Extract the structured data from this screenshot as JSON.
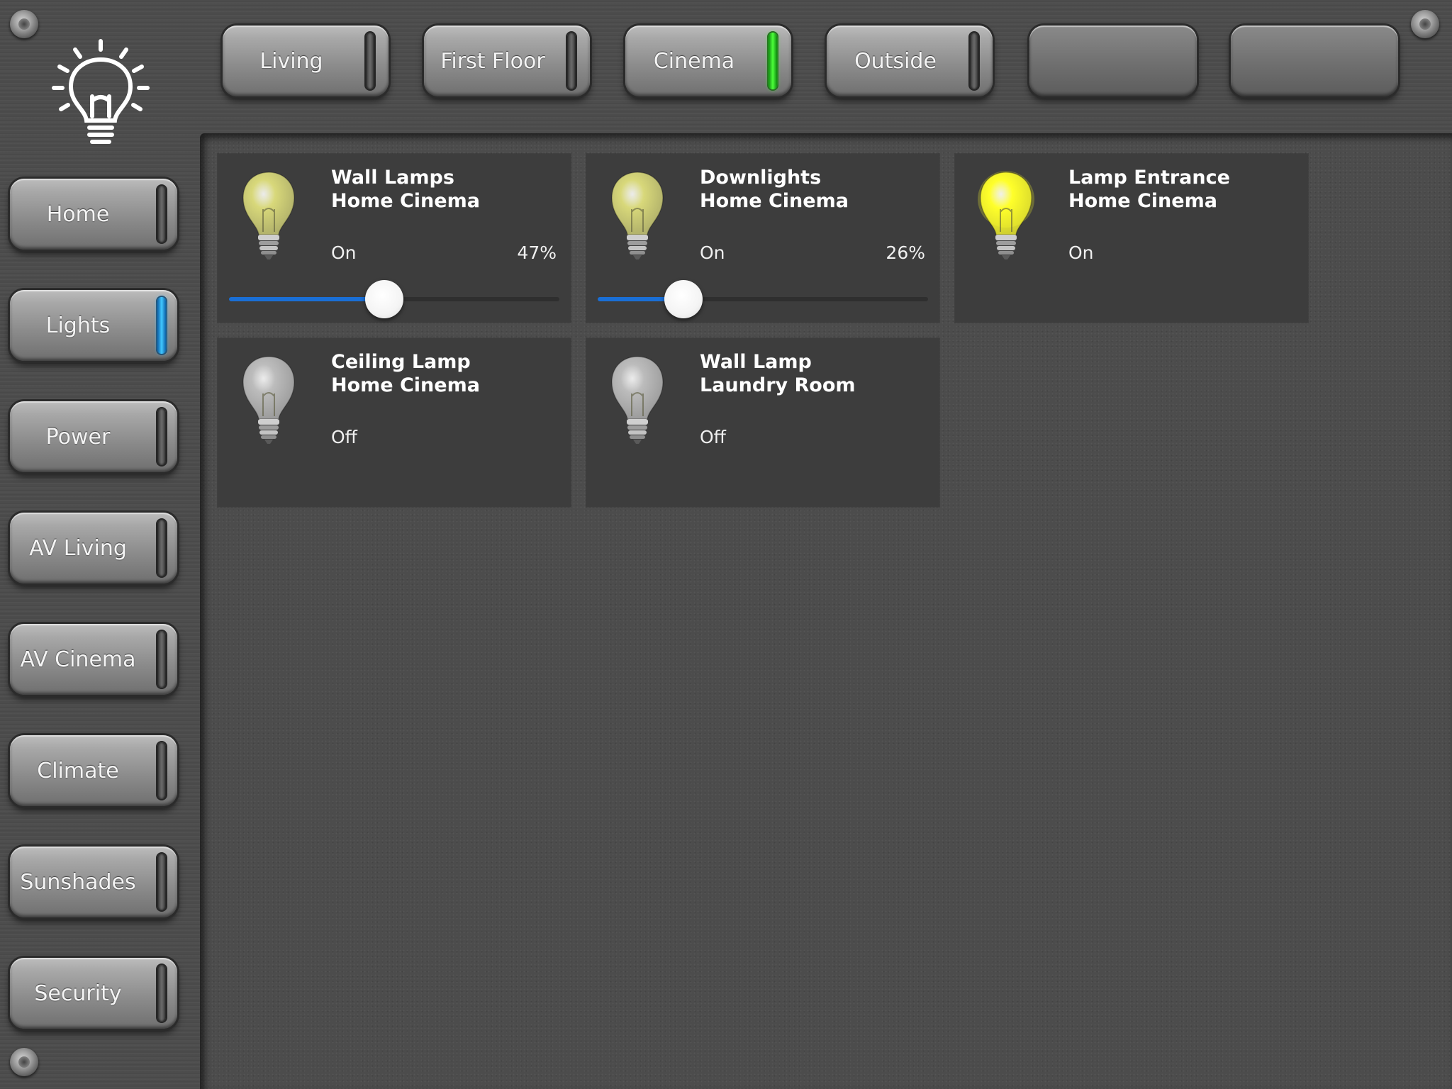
{
  "tabs": [
    {
      "label": "Living",
      "indicator": "off"
    },
    {
      "label": "First Floor",
      "indicator": "off"
    },
    {
      "label": "Cinema",
      "indicator": "green"
    },
    {
      "label": "Outside",
      "indicator": "off"
    },
    {
      "label": "",
      "indicator": "none"
    },
    {
      "label": "",
      "indicator": "none"
    }
  ],
  "sidebar": {
    "items": [
      {
        "label": "Home",
        "indicator": "off"
      },
      {
        "label": "Lights",
        "indicator": "blue"
      },
      {
        "label": "Power",
        "indicator": "off"
      },
      {
        "label": "AV Living",
        "indicator": "off"
      },
      {
        "label": "AV Cinema",
        "indicator": "off"
      },
      {
        "label": "Climate",
        "indicator": "off"
      },
      {
        "label": "Sunshades",
        "indicator": "off"
      },
      {
        "label": "Security",
        "indicator": "off"
      }
    ]
  },
  "lights": [
    {
      "name": "Wall Lamps",
      "room": "Home Cinema",
      "state": "On",
      "level_text": "47%",
      "level": 0.47,
      "dimmable": true,
      "bulb": "dim"
    },
    {
      "name": "Downlights",
      "room": "Home Cinema",
      "state": "On",
      "level_text": "26%",
      "level": 0.26,
      "dimmable": true,
      "bulb": "dim"
    },
    {
      "name": "Lamp Entrance",
      "room": "Home Cinema",
      "state": "On",
      "dimmable": false,
      "bulb": "bright"
    },
    {
      "name": "Ceiling Lamp",
      "room": "Home Cinema",
      "state": "Off",
      "dimmable": false,
      "bulb": "off"
    },
    {
      "name": "Wall Lamp",
      "room": "Laundry Room",
      "state": "Off",
      "dimmable": false,
      "bulb": "off"
    }
  ],
  "colors": {
    "accent_slider": "#1a6fd6",
    "indicator_green": "#3bff2a",
    "indicator_blue": "#39b7ff",
    "bulb_bright": "#ffff2a",
    "bulb_dim": "#d8d87a",
    "bulb_off": "#bcbcbc"
  },
  "icons": {
    "logo": "lightbulb-logo-icon",
    "bulb": "lightbulb-icon",
    "screw": "screw-icon"
  }
}
